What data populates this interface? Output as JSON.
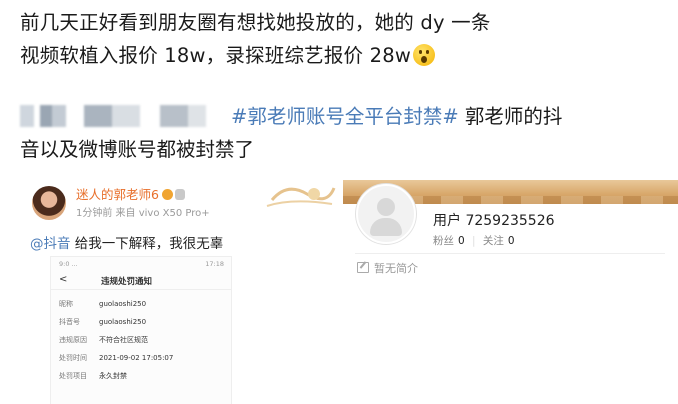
{
  "caption": {
    "line1": "前几天正好看到朋友圈有想找她投放的，她的 dy 一条",
    "line2": "视频软植入报价 18w，录探班综艺报价 28w",
    "emoji": "surprised-face-emoji"
  },
  "repost": {
    "hashtag": "#郭老师账号全平台封禁#",
    "text_after_hashtag": " 郭老师的抖",
    "line2": "音以及微博账号都被封禁了"
  },
  "left_screenshot": {
    "username": "迷人的郭老师6",
    "meta": "1分钟前  来自 vivo X50 Pro+",
    "mention": "@抖音",
    "post_text": " 给我一下解释，我很无辜",
    "notice": {
      "status_left": "9:0 ...",
      "status_right": "17:18",
      "back": "<",
      "title": "违规处罚通知",
      "rows": [
        {
          "key": "昵称",
          "value": "guolaoshi250"
        },
        {
          "key": "抖音号",
          "value": "guolaoshi250"
        },
        {
          "key": "违规原因",
          "value": "不符合社区规范"
        },
        {
          "key": "处罚时间",
          "value": "2021-09-02 17:05:07"
        },
        {
          "key": "处罚项目",
          "value": "永久封禁"
        }
      ]
    }
  },
  "right_screenshot": {
    "username": "用户 7259235526",
    "fans_label": "粉丝",
    "fans_count": "0",
    "follow_label": "关注",
    "follow_count": "0",
    "intro": "暂无简介"
  }
}
